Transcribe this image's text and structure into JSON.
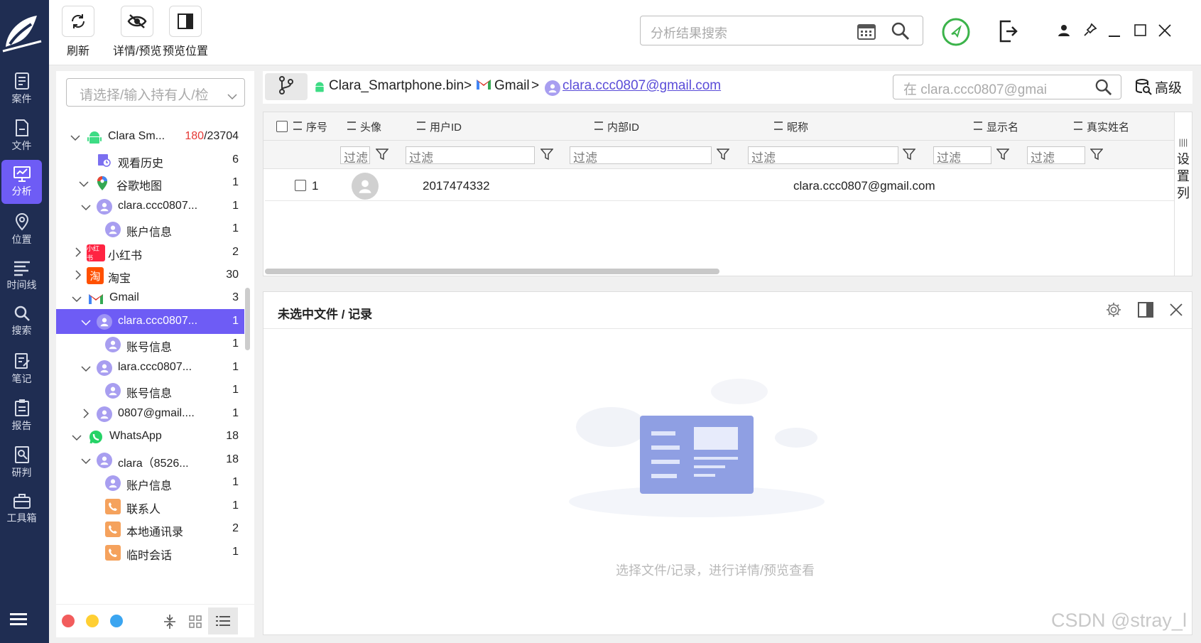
{
  "toolbar": {
    "refresh_label": "刷新",
    "detail_label": "详情/预览",
    "preview_pos_label": "预览位置",
    "search_placeholder": "分析结果搜索"
  },
  "nav": {
    "items": [
      {
        "label": "案件",
        "icon": "case-icon"
      },
      {
        "label": "文件",
        "icon": "file-icon"
      },
      {
        "label": "分析",
        "icon": "analysis-icon"
      },
      {
        "label": "位置",
        "icon": "location-icon"
      },
      {
        "label": "时间线",
        "icon": "timeline-icon"
      },
      {
        "label": "搜索",
        "icon": "search-icon"
      },
      {
        "label": "笔记",
        "icon": "note-icon"
      },
      {
        "label": "报告",
        "icon": "report-icon"
      },
      {
        "label": "研判",
        "icon": "judge-icon"
      },
      {
        "label": "工具箱",
        "icon": "toolbox-icon"
      }
    ]
  },
  "tree": {
    "holder_placeholder": "请选择/输入持有人/检",
    "root_label": "Clara Sm...",
    "root_count_red": "180",
    "root_count_total": "/23704",
    "rows": [
      {
        "label": "观看历史",
        "count": "6"
      },
      {
        "label": "谷歌地图",
        "count": "1"
      },
      {
        "label": "clara.ccc0807...",
        "count": "1"
      },
      {
        "label": "账户信息",
        "count": "1"
      },
      {
        "label": "小红书",
        "count": "2",
        "icon_text": "小红书"
      },
      {
        "label": "淘宝",
        "count": "30",
        "icon_text": "淘"
      },
      {
        "label": "Gmail",
        "count": "3"
      },
      {
        "label": "clara.ccc0807...",
        "count": "1"
      },
      {
        "label": "账号信息",
        "count": "1"
      },
      {
        "label": "lara.ccc0807...",
        "count": "1"
      },
      {
        "label": "账号信息",
        "count": "1"
      },
      {
        "label": "0807@gmail....",
        "count": "1"
      },
      {
        "label": "WhatsApp",
        "count": "18"
      },
      {
        "label": "clara（8526...",
        "count": "18"
      },
      {
        "label": "账户信息",
        "count": "1"
      },
      {
        "label": "联系人",
        "count": "1"
      },
      {
        "label": "本地通讯录",
        "count": "2"
      },
      {
        "label": "临时会话",
        "count": "1"
      }
    ]
  },
  "breadcrumb": {
    "items": [
      "Clara_Smartphone.bin",
      "Gmail",
      "clara.ccc0807@gmail.com"
    ],
    "separator": ">",
    "search_placeholder": "在 clara.ccc0807@gmai",
    "advanced_label": "高级"
  },
  "table": {
    "columns": [
      "序号",
      "头像",
      "用户ID",
      "内部ID",
      "昵称",
      "显示名",
      "真实姓名"
    ],
    "filter_label": "过滤",
    "rows": [
      {
        "index": "1",
        "user_id": "2017474332",
        "internal_id": "",
        "nickname": "clara.ccc0807@gmail.com",
        "display_name": "",
        "real_name": ""
      }
    ],
    "set_columns_label": "设置列"
  },
  "preview": {
    "title": "未选中文件 / 记录",
    "empty_text": "选择文件/记录，进行详情/预览查看"
  },
  "watermark": "CSDN @stray_l",
  "colors": {
    "nav_bg": "#1f2d52",
    "accent": "#6e5cf5",
    "brand_green": "#3bb34a",
    "gmail_red": "#d93025"
  }
}
